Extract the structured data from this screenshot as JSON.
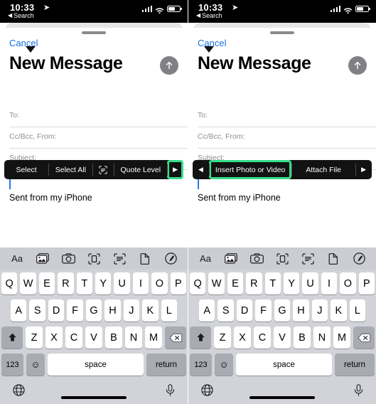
{
  "meta": {
    "accent_green": "#35dd8a",
    "link_blue": "#1a6fe0",
    "menu_bg": "#121212"
  },
  "status_bar": {
    "time": "10:33",
    "location_arrow": "location-arrow-icon",
    "back_label": "Search",
    "back_arrow": "triangle-left-icon",
    "signal": "cellular-signal-icon",
    "wifi": "wifi-icon",
    "battery": "battery-icon"
  },
  "compose": {
    "cancel_label": "Cancel",
    "title": "New Message",
    "send_button": "send-arrow-icon",
    "fields": [
      {
        "label": "To:",
        "value": ""
      },
      {
        "label": "Cc/Bcc, From:",
        "value": ""
      },
      {
        "label": "Subject:",
        "value": ""
      }
    ],
    "body_signature": "Sent from my iPhone"
  },
  "panels": [
    {
      "id": "left",
      "edit_menu": {
        "left_arrow": null,
        "items": [
          {
            "label": "Select",
            "icon": null,
            "highlighted": false
          },
          {
            "label": "Select All",
            "icon": null,
            "highlighted": false
          },
          {
            "label": "",
            "icon": "scan-text-icon",
            "highlighted": false
          },
          {
            "label": "Quote Level",
            "icon": null,
            "highlighted": false
          }
        ],
        "right_arrow": "triangle-right-icon",
        "right_arrow_highlighted": true
      }
    },
    {
      "id": "right",
      "edit_menu": {
        "left_arrow": "triangle-left-icon",
        "items": [
          {
            "label": "Insert Photo or Video",
            "icon": null,
            "highlighted": true
          },
          {
            "label": "Attach File",
            "icon": null,
            "highlighted": false
          }
        ],
        "right_arrow": "triangle-right-icon",
        "right_arrow_highlighted": false
      }
    }
  ],
  "format_bar": {
    "items": [
      {
        "name": "text-format-icon",
        "glyph": "Aa"
      },
      {
        "name": "photo-library-icon",
        "glyph": "photo"
      },
      {
        "name": "camera-icon",
        "glyph": "camera"
      },
      {
        "name": "scan-document-icon",
        "glyph": "scandoc"
      },
      {
        "name": "scan-text-icon",
        "glyph": "scantext"
      },
      {
        "name": "attach-file-icon",
        "glyph": "page"
      },
      {
        "name": "markup-icon",
        "glyph": "markup"
      }
    ]
  },
  "keyboard": {
    "row1": [
      "Q",
      "W",
      "E",
      "R",
      "T",
      "Y",
      "U",
      "I",
      "O",
      "P"
    ],
    "row2": [
      "A",
      "S",
      "D",
      "F",
      "G",
      "H",
      "J",
      "K",
      "L"
    ],
    "row3": [
      "Z",
      "X",
      "C",
      "V",
      "B",
      "N",
      "M"
    ],
    "shift_key": "shift-icon",
    "delete_key": "delete-icon",
    "numbers_key": "123",
    "emoji_key": "emoji-icon",
    "space_key": "space",
    "return_key": "return",
    "globe_key": "globe-icon",
    "dictation_key": "microphone-icon"
  }
}
